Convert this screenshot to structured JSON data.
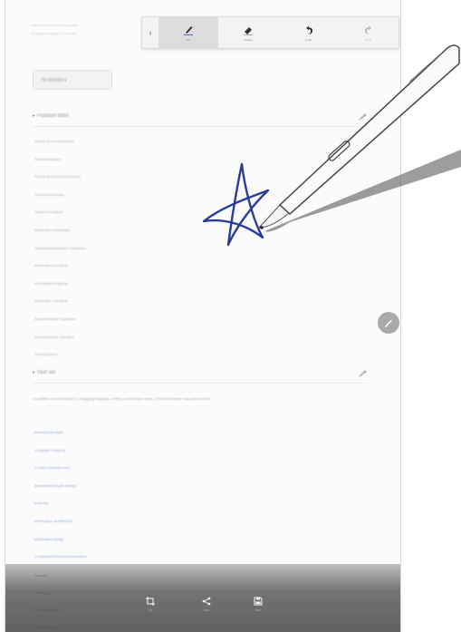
{
  "page_header_lines": [
    "Lorem ipsum dolor sit amet consectetur",
    "formatting, and delivery of information"
  ],
  "sort_dropdown": {
    "value": "TS  500000  ▾"
  },
  "section1": {
    "title": "Position titles",
    "items": [
      "Technical Communicator",
      "Technical author",
      "Technical Content Developer",
      "Content Developer",
      "Content Designer",
      "Information Developer",
      "Technical Information Developer",
      "Information Architect",
      "Information Engineer",
      "Information Designer",
      "Documentation Specialist",
      "Documentation Manager",
      "Tech Engineer"
    ]
  },
  "section2": {
    "title": "Skill set",
    "description": "In addition to solid research, engaging language, writing, and revision skills, a technical writer may also need to:",
    "items": [
      "Business Analysis",
      "Computer Scripting",
      "Content management",
      "Illustration/Graphic design",
      "Indexing",
      "Information architecture",
      "Information design",
      "Localization/Technical translation"
    ]
  },
  "under_bottom_items": [
    "Training",
    "Scripting",
    "User interfaces",
    "Video editing"
  ],
  "toolbar": {
    "items": [
      {
        "label": "Pen",
        "icon": "pen-icon"
      },
      {
        "label": "Eraser",
        "icon": "eraser-icon"
      },
      {
        "label": "Undo",
        "icon": "undo-icon"
      },
      {
        "label": "Redo",
        "icon": "redo-icon"
      }
    ]
  },
  "bottombar": {
    "items": [
      {
        "label": "Crop",
        "icon": "crop-icon"
      },
      {
        "label": "Share",
        "icon": "share-icon"
      },
      {
        "label": "Save",
        "icon": "save-icon"
      }
    ]
  },
  "colors": {
    "ink": "#2a3d96",
    "accent_link": "#7e98cf",
    "toolbar_bg": "#f3f3f3"
  }
}
